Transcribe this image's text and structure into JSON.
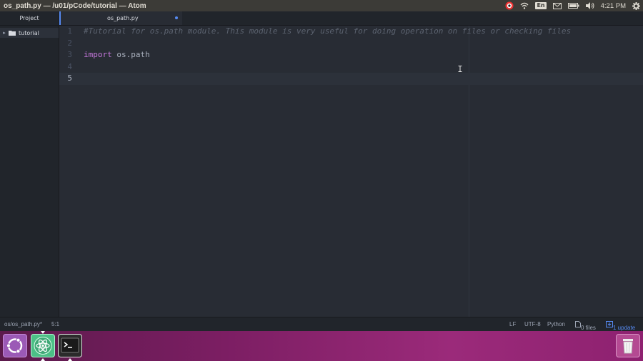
{
  "window": {
    "title": "os_path.py — /u01/pCode/tutorial — Atom"
  },
  "tray": {
    "keyboard_layout": "En",
    "clock": "4:21 PM",
    "icons": [
      "screen-recorder-icon",
      "wifi-icon",
      "keyboard-icon",
      "mail-icon",
      "battery-icon",
      "volume-icon",
      "gear-icon"
    ]
  },
  "tree_view": {
    "tab_label": "Project",
    "root_folder": "tutorial"
  },
  "editor": {
    "tab": {
      "label": "os_path.py",
      "modified": true
    },
    "line_numbers": [
      "1",
      "2",
      "3",
      "4",
      "5"
    ],
    "lines": [
      {
        "comment": "#Tutorial for os.path module. This module is very useful for doing operation on files or checking files"
      },
      {
        "text": ""
      },
      {
        "keyword": "import",
        "rest": " os.path"
      },
      {
        "text": ""
      },
      {
        "text": ""
      }
    ],
    "cursor_line": 5
  },
  "status_bar": {
    "file_path": "os/os_path.py*",
    "cursor_position": "5:1",
    "line_ending": "LF",
    "encoding": "UTF-8",
    "grammar": "Python",
    "git_files": "0 files",
    "updates": "1 update"
  },
  "dock": {
    "items": [
      "ubuntu-launcher",
      "atom-editor",
      "terminal",
      "trash"
    ]
  },
  "colors": {
    "accent": "#568af2",
    "comment": "#5c6370",
    "keyword": "#c678dd",
    "editor_bg": "#282c34"
  }
}
